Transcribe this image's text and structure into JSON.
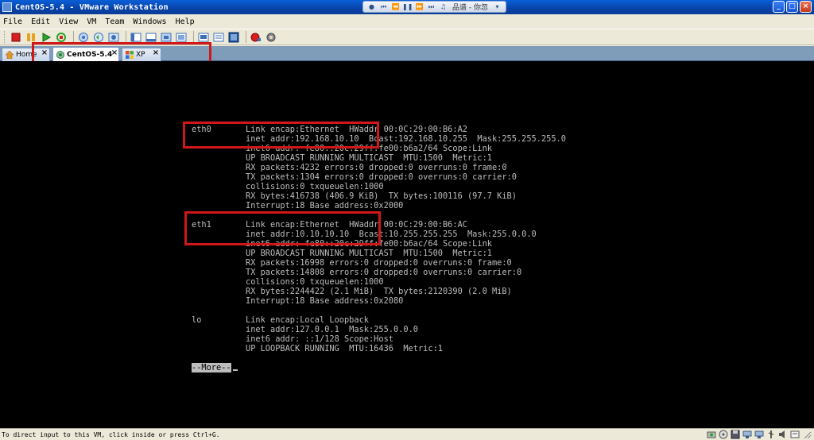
{
  "window": {
    "title": "CentOS-5.4 - VMware Workstation",
    "media_text": "品谱 - 你忽",
    "min_label": "_",
    "max_label": "□",
    "close_label": "×"
  },
  "menu": [
    "File",
    "Edit",
    "View",
    "VM",
    "Team",
    "Windows",
    "Help"
  ],
  "tabs": {
    "home": "Home",
    "centos": "CentOS-5.4",
    "xp": "XP",
    "close_glyph": "×"
  },
  "console": {
    "lines": [
      {
        "iface": "eth0",
        "text": "Link encap:Ethernet  HWaddr 00:0C:29:00:B6:A2"
      },
      {
        "iface": "",
        "text": "inet addr:192.168.10.10  Bcast:192.168.10.255  Mask:255.255.255.0"
      },
      {
        "iface": "",
        "text": "inet6 addr: fe80::20c:29ff:fe00:b6a2/64 Scope:Link"
      },
      {
        "iface": "",
        "text": "UP BROADCAST RUNNING MULTICAST  MTU:1500  Metric:1"
      },
      {
        "iface": "",
        "text": "RX packets:4232 errors:0 dropped:0 overruns:0 frame:0"
      },
      {
        "iface": "",
        "text": "TX packets:1304 errors:0 dropped:0 overruns:0 carrier:0"
      },
      {
        "iface": "",
        "text": "collisions:0 txqueuelen:1000"
      },
      {
        "iface": "",
        "text": "RX bytes:416738 (406.9 KiB)  TX bytes:100116 (97.7 KiB)"
      },
      {
        "iface": "",
        "text": "Interrupt:18 Base address:0x2000"
      },
      {
        "iface": "",
        "text": ""
      },
      {
        "iface": "eth1",
        "text": "Link encap:Ethernet  HWaddr 00:0C:29:00:B6:AC"
      },
      {
        "iface": "",
        "text": "inet addr:10.10.10.10  Bcast:10.255.255.255  Mask:255.0.0.0"
      },
      {
        "iface": "",
        "text": "inet6 addr: fe80::20c:29ff:fe00:b6ac/64 Scope:Link"
      },
      {
        "iface": "",
        "text": "UP BROADCAST RUNNING MULTICAST  MTU:1500  Metric:1"
      },
      {
        "iface": "",
        "text": "RX packets:16998 errors:0 dropped:0 overruns:0 frame:0"
      },
      {
        "iface": "",
        "text": "TX packets:14808 errors:0 dropped:0 overruns:0 carrier:0"
      },
      {
        "iface": "",
        "text": "collisions:0 txqueuelen:1000"
      },
      {
        "iface": "",
        "text": "RX bytes:2244422 (2.1 MiB)  TX bytes:2120390 (2.0 MiB)"
      },
      {
        "iface": "",
        "text": "Interrupt:18 Base address:0x2080"
      },
      {
        "iface": "",
        "text": ""
      },
      {
        "iface": "lo",
        "text": "Link encap:Local Loopback"
      },
      {
        "iface": "",
        "text": "inet addr:127.0.0.1  Mask:255.0.0.0"
      },
      {
        "iface": "",
        "text": "inet6 addr: ::1/128 Scope:Host"
      },
      {
        "iface": "",
        "text": "UP LOOPBACK RUNNING  MTU:16436  Metric:1"
      },
      {
        "iface": "",
        "text": ""
      }
    ],
    "more_prompt": "--More--"
  },
  "statusbar": {
    "text": "To direct input to this VM, click inside or press Ctrl+G."
  }
}
